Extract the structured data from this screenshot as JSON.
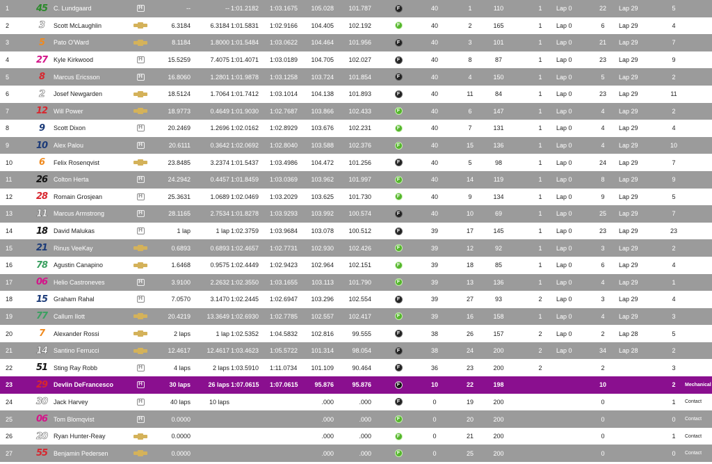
{
  "table": {
    "rows": [
      {
        "pos": "1",
        "num": "45",
        "num_color": "#2a8a2a",
        "driver": "C. Lundgaard",
        "engine": "honda",
        "gap": "--",
        "int": "--",
        "last": "1:01.2182",
        "best": "1:03.1675",
        "lspd": "105.028",
        "bspd": "101.787",
        "tire": "black",
        "laps": "40",
        "s1": "1",
        "s2": "110",
        "stops": "1",
        "llap": "Lap 0",
        "led": "22",
        "lapno": "Lap 29",
        "pit": "5",
        "reason": ""
      },
      {
        "pos": "2",
        "num": "3",
        "num_color": "#ffffff",
        "driver": "Scott McLaughlin",
        "engine": "chevy",
        "gap": "6.3184",
        "int": "6.3184",
        "last": "1:01.5831",
        "best": "1:02.9166",
        "lspd": "104.405",
        "bspd": "102.192",
        "tire": "green",
        "laps": "40",
        "s1": "2",
        "s2": "165",
        "stops": "1",
        "llap": "Lap 0",
        "led": "6",
        "lapno": "Lap 29",
        "pit": "4",
        "reason": ""
      },
      {
        "pos": "3",
        "num": "5",
        "num_color": "#f08a1e",
        "driver": "Pato O'Ward",
        "engine": "chevy",
        "gap": "8.1184",
        "int": "1.8000",
        "last": "1:01.5484",
        "best": "1:03.0622",
        "lspd": "104.464",
        "bspd": "101.956",
        "tire": "black",
        "laps": "40",
        "s1": "3",
        "s2": "101",
        "stops": "1",
        "llap": "Lap 0",
        "led": "21",
        "lapno": "Lap 29",
        "pit": "7",
        "reason": ""
      },
      {
        "pos": "4",
        "num": "27",
        "num_color": "#d4148a",
        "driver": "Kyle Kirkwood",
        "engine": "honda",
        "gap": "15.5259",
        "int": "7.4075",
        "last": "1:01.4071",
        "best": "1:03.0189",
        "lspd": "104.705",
        "bspd": "102.027",
        "tire": "black",
        "laps": "40",
        "s1": "8",
        "s2": "87",
        "stops": "1",
        "llap": "Lap 0",
        "led": "23",
        "lapno": "Lap 29",
        "pit": "9",
        "reason": ""
      },
      {
        "pos": "5",
        "num": "8",
        "num_color": "#d8262e",
        "driver": "Marcus Ericsson",
        "engine": "honda",
        "gap": "16.8060",
        "int": "1.2801",
        "last": "1:01.9878",
        "best": "1:03.1258",
        "lspd": "103.724",
        "bspd": "101.854",
        "tire": "black",
        "laps": "40",
        "s1": "4",
        "s2": "150",
        "stops": "1",
        "llap": "Lap 0",
        "led": "5",
        "lapno": "Lap 29",
        "pit": "2",
        "reason": ""
      },
      {
        "pos": "6",
        "num": "2",
        "num_color": "#ffffff",
        "driver": "Josef Newgarden",
        "engine": "chevy",
        "gap": "18.5124",
        "int": "1.7064",
        "last": "1:01.7412",
        "best": "1:03.1014",
        "lspd": "104.138",
        "bspd": "101.893",
        "tire": "black",
        "laps": "40",
        "s1": "11",
        "s2": "84",
        "stops": "1",
        "llap": "Lap 0",
        "led": "23",
        "lapno": "Lap 29",
        "pit": "11",
        "reason": ""
      },
      {
        "pos": "7",
        "num": "12",
        "num_color": "#d8262e",
        "driver": "Will Power",
        "engine": "chevy",
        "gap": "18.9773",
        "int": "0.4649",
        "last": "1:01.9030",
        "best": "1:02.7687",
        "lspd": "103.866",
        "bspd": "102.433",
        "tire": "green",
        "laps": "40",
        "s1": "6",
        "s2": "147",
        "stops": "1",
        "llap": "Lap 0",
        "led": "4",
        "lapno": "Lap 29",
        "pit": "2",
        "reason": ""
      },
      {
        "pos": "8",
        "num": "9",
        "num_color": "#1b3a78",
        "driver": "Scott Dixon",
        "engine": "honda",
        "gap": "20.2469",
        "int": "1.2696",
        "last": "1:02.0162",
        "best": "1:02.8929",
        "lspd": "103.676",
        "bspd": "102.231",
        "tire": "green",
        "laps": "40",
        "s1": "7",
        "s2": "131",
        "stops": "1",
        "llap": "Lap 0",
        "led": "4",
        "lapno": "Lap 29",
        "pit": "4",
        "reason": ""
      },
      {
        "pos": "9",
        "num": "10",
        "num_color": "#1b3a78",
        "driver": "Alex Palou",
        "engine": "honda",
        "gap": "20.6111",
        "int": "0.3642",
        "last": "1:02.0692",
        "best": "1:02.8040",
        "lspd": "103.588",
        "bspd": "102.376",
        "tire": "green",
        "laps": "40",
        "s1": "15",
        "s2": "136",
        "stops": "1",
        "llap": "Lap 0",
        "led": "4",
        "lapno": "Lap 29",
        "pit": "10",
        "reason": ""
      },
      {
        "pos": "10",
        "num": "6",
        "num_color": "#f08a1e",
        "driver": "Felix Rosenqvist",
        "engine": "chevy",
        "gap": "23.8485",
        "int": "3.2374",
        "last": "1:01.5437",
        "best": "1:03.4986",
        "lspd": "104.472",
        "bspd": "101.256",
        "tire": "black",
        "laps": "40",
        "s1": "5",
        "s2": "98",
        "stops": "1",
        "llap": "Lap 0",
        "led": "24",
        "lapno": "Lap 29",
        "pit": "7",
        "reason": ""
      },
      {
        "pos": "11",
        "num": "26",
        "num_color": "#111111",
        "driver": "Colton Herta",
        "engine": "honda",
        "gap": "24.2942",
        "int": "0.4457",
        "last": "1:01.8459",
        "best": "1:03.0369",
        "lspd": "103.962",
        "bspd": "101.997",
        "tire": "green",
        "laps": "40",
        "s1": "14",
        "s2": "119",
        "stops": "1",
        "llap": "Lap 0",
        "led": "8",
        "lapno": "Lap 29",
        "pit": "9",
        "reason": ""
      },
      {
        "pos": "12",
        "num": "28",
        "num_color": "#d8262e",
        "driver": "Romain Grosjean",
        "engine": "honda",
        "gap": "25.3631",
        "int": "1.0689",
        "last": "1:02.0469",
        "best": "1:03.2029",
        "lspd": "103.625",
        "bspd": "101.730",
        "tire": "green",
        "laps": "40",
        "s1": "9",
        "s2": "134",
        "stops": "1",
        "llap": "Lap 0",
        "led": "9",
        "lapno": "Lap 29",
        "pit": "5",
        "reason": ""
      },
      {
        "pos": "13",
        "num": "11",
        "num_color": "#ffffff",
        "driver": "Marcus Armstrong",
        "engine": "honda",
        "gap": "28.1165",
        "int": "2.7534",
        "last": "1:01.8278",
        "best": "1:03.9293",
        "lspd": "103.992",
        "bspd": "100.574",
        "tire": "black",
        "laps": "40",
        "s1": "10",
        "s2": "69",
        "stops": "1",
        "llap": "Lap 0",
        "led": "25",
        "lapno": "Lap 29",
        "pit": "7",
        "reason": ""
      },
      {
        "pos": "14",
        "num": "18",
        "num_color": "#111111",
        "driver": "David Malukas",
        "engine": "honda",
        "gap": "1 lap",
        "int": "1 lap",
        "last": "1:02.3759",
        "best": "1:03.9684",
        "lspd": "103.078",
        "bspd": "100.512",
        "tire": "black",
        "laps": "39",
        "s1": "17",
        "s2": "145",
        "stops": "1",
        "llap": "Lap 0",
        "led": "23",
        "lapno": "Lap 29",
        "pit": "23",
        "reason": ""
      },
      {
        "pos": "15",
        "num": "21",
        "num_color": "#1b3a78",
        "driver": "Rinus VeeKay",
        "engine": "chevy",
        "gap": "0.6893",
        "int": "0.6893",
        "last": "1:02.4657",
        "best": "1:02.7731",
        "lspd": "102.930",
        "bspd": "102.426",
        "tire": "green",
        "laps": "39",
        "s1": "12",
        "s2": "92",
        "stops": "1",
        "llap": "Lap 0",
        "led": "3",
        "lapno": "Lap 29",
        "pit": "2",
        "reason": ""
      },
      {
        "pos": "16",
        "num": "78",
        "num_color": "#3aa060",
        "driver": "Agustin Canapino",
        "engine": "chevy",
        "gap": "1.6468",
        "int": "0.9575",
        "last": "1:02.4449",
        "best": "1:02.9423",
        "lspd": "102.964",
        "bspd": "102.151",
        "tire": "green",
        "laps": "39",
        "s1": "18",
        "s2": "85",
        "stops": "1",
        "llap": "Lap 0",
        "led": "6",
        "lapno": "Lap 29",
        "pit": "4",
        "reason": ""
      },
      {
        "pos": "17",
        "num": "06",
        "num_color": "#d4148a",
        "driver": "Helio Castroneves",
        "engine": "honda",
        "gap": "3.9100",
        "int": "2.2632",
        "last": "1:02.3550",
        "best": "1:03.1655",
        "lspd": "103.113",
        "bspd": "101.790",
        "tire": "green",
        "laps": "39",
        "s1": "13",
        "s2": "136",
        "stops": "1",
        "llap": "Lap 0",
        "led": "4",
        "lapno": "Lap 29",
        "pit": "1",
        "reason": ""
      },
      {
        "pos": "18",
        "num": "15",
        "num_color": "#1b3a78",
        "driver": "Graham Rahal",
        "engine": "honda",
        "gap": "7.0570",
        "int": "3.1470",
        "last": "1:02.2445",
        "best": "1:02.6947",
        "lspd": "103.296",
        "bspd": "102.554",
        "tire": "black",
        "laps": "39",
        "s1": "27",
        "s2": "93",
        "stops": "2",
        "llap": "Lap 0",
        "led": "3",
        "lapno": "Lap 29",
        "pit": "4",
        "reason": ""
      },
      {
        "pos": "19",
        "num": "77",
        "num_color": "#3aa060",
        "driver": "Callum Ilott",
        "engine": "chevy",
        "gap": "20.4219",
        "int": "13.3649",
        "last": "1:02.6930",
        "best": "1:02.7785",
        "lspd": "102.557",
        "bspd": "102.417",
        "tire": "green",
        "laps": "39",
        "s1": "16",
        "s2": "158",
        "stops": "1",
        "llap": "Lap 0",
        "led": "4",
        "lapno": "Lap 29",
        "pit": "3",
        "reason": ""
      },
      {
        "pos": "20",
        "num": "7",
        "num_color": "#f08a1e",
        "driver": "Alexander Rossi",
        "engine": "chevy",
        "gap": "2 laps",
        "int": "1 lap",
        "last": "1:02.5352",
        "best": "1:04.5832",
        "lspd": "102.816",
        "bspd": "99.555",
        "tire": "black",
        "laps": "38",
        "s1": "26",
        "s2": "157",
        "stops": "2",
        "llap": "Lap 0",
        "led": "2",
        "lapno": "Lap 28",
        "pit": "5",
        "reason": ""
      },
      {
        "pos": "21",
        "num": "14",
        "num_color": "#ffffff",
        "driver": "Santino Ferrucci",
        "engine": "chevy",
        "gap": "12.4617",
        "int": "12.4617",
        "last": "1:03.4623",
        "best": "1:05.5722",
        "lspd": "101.314",
        "bspd": "98.054",
        "tire": "black",
        "laps": "38",
        "s1": "24",
        "s2": "200",
        "stops": "2",
        "llap": "Lap 0",
        "led": "34",
        "lapno": "Lap 28",
        "pit": "2",
        "reason": ""
      },
      {
        "pos": "22",
        "num": "51",
        "num_color": "#111111",
        "driver": "Sting Ray Robb",
        "engine": "honda",
        "gap": "4 laps",
        "int": "2 laps",
        "last": "1:03.5910",
        "best": "1:11.0734",
        "lspd": "101.109",
        "bspd": "90.464",
        "tire": "black",
        "laps": "36",
        "s1": "23",
        "s2": "200",
        "stops": "2",
        "llap": "",
        "led": "2",
        "lapno": "",
        "pit": "3",
        "reason": ""
      },
      {
        "pos": "23",
        "num": "29",
        "num_color": "#d8262e",
        "driver": "Devlin DeFrancesco",
        "engine": "honda",
        "gap": "30 laps",
        "int": "26 laps",
        "last": "1:07.0615",
        "best": "1:07.0615",
        "lspd": "95.876",
        "bspd": "95.876",
        "tire": "black",
        "laps": "10",
        "s1": "22",
        "s2": "198",
        "stops": "",
        "llap": "",
        "led": "10",
        "lapno": "",
        "pit": "2",
        "reason": "Mechanical",
        "highlight": true
      },
      {
        "pos": "24",
        "num": "30",
        "num_color": "#ffffff",
        "driver": "Jack Harvey",
        "engine": "honda",
        "gap": "40 laps",
        "int": "10 laps",
        "last": "",
        "best": "",
        "lspd": ".000",
        "bspd": ".000",
        "tire": "black",
        "laps": "0",
        "s1": "19",
        "s2": "200",
        "stops": "",
        "llap": "",
        "led": "0",
        "lapno": "",
        "pit": "1",
        "reason": "Contact"
      },
      {
        "pos": "25",
        "num": "06",
        "num_color": "#d4148a",
        "driver": "Tom Blomqvist",
        "engine": "honda",
        "gap": "0.0000",
        "int": "",
        "last": "",
        "best": "",
        "lspd": ".000",
        "bspd": ".000",
        "tire": "green",
        "laps": "0",
        "s1": "20",
        "s2": "200",
        "stops": "",
        "llap": "",
        "led": "0",
        "lapno": "",
        "pit": "0",
        "reason": "Contact"
      },
      {
        "pos": "26",
        "num": "20",
        "num_color": "#ffffff",
        "driver": "Ryan Hunter-Reay",
        "engine": "chevy",
        "gap": "0.0000",
        "int": "",
        "last": "",
        "best": "",
        "lspd": ".000",
        "bspd": ".000",
        "tire": "green",
        "laps": "0",
        "s1": "21",
        "s2": "200",
        "stops": "",
        "llap": "",
        "led": "0",
        "lapno": "",
        "pit": "1",
        "reason": "Contact"
      },
      {
        "pos": "27",
        "num": "55",
        "num_color": "#d8262e",
        "driver": "Benjamin Pedersen",
        "engine": "chevy",
        "gap": "0.0000",
        "int": "",
        "last": "",
        "best": "",
        "lspd": ".000",
        "bspd": ".000",
        "tire": "green",
        "laps": "0",
        "s1": "25",
        "s2": "200",
        "stops": "",
        "llap": "",
        "led": "0",
        "lapno": "",
        "pit": "0",
        "reason": "Contact"
      }
    ]
  },
  "colors": {
    "odd_row": "#9b9b9b",
    "even_row": "#ffffff",
    "highlight_row": "#8a0f8f",
    "chevy_gold": "#d4b25a",
    "tire_green": "#54b52b",
    "tire_black": "#222222"
  }
}
